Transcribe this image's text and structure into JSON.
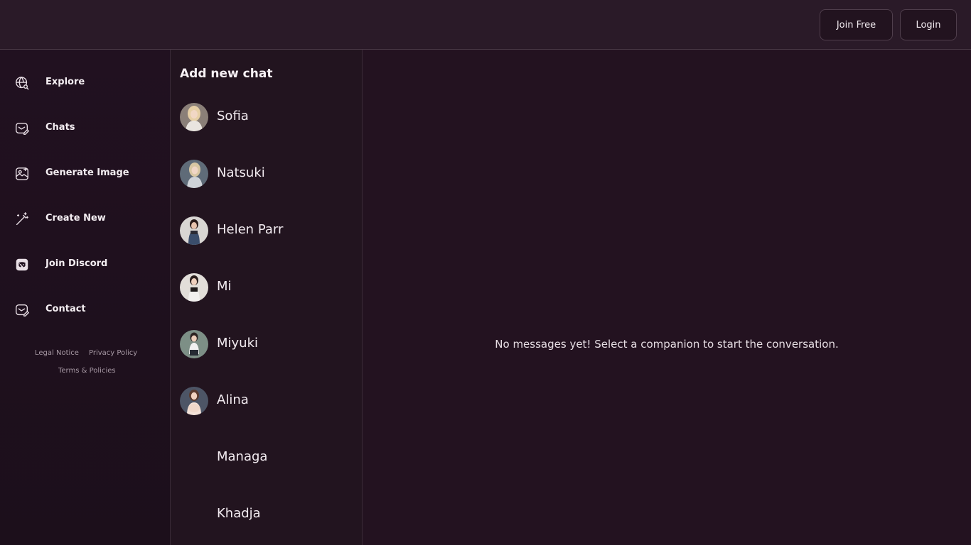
{
  "header": {
    "join_label": "Join Free",
    "login_label": "Login"
  },
  "sidebar": {
    "items": [
      {
        "label": "Explore",
        "icon": "globe-search-icon"
      },
      {
        "label": "Chats",
        "icon": "chat-edit-icon"
      },
      {
        "label": "Generate Image",
        "icon": "image-generate-icon"
      },
      {
        "label": "Create New",
        "icon": "magic-wand-icon"
      },
      {
        "label": "Join Discord",
        "icon": "discord-icon"
      },
      {
        "label": "Contact",
        "icon": "mail-edit-icon"
      }
    ],
    "footer": {
      "legal": "Legal Notice",
      "privacy": "Privacy Policy",
      "terms": "Terms & Policies"
    }
  },
  "contacts": {
    "title": "Add new chat",
    "items": [
      {
        "name": "Sofia"
      },
      {
        "name": "Natsuki"
      },
      {
        "name": "Helen Parr"
      },
      {
        "name": "Mi"
      },
      {
        "name": "Miyuki"
      },
      {
        "name": "Alina"
      },
      {
        "name": "Managa"
      },
      {
        "name": "Khadja"
      }
    ]
  },
  "main": {
    "empty_message": "No messages yet! Select a companion to start the conversation."
  },
  "colors": {
    "background": "#22111f",
    "header": "#2a1a28",
    "border": "#4a3a47",
    "text": "#f1e9ef"
  }
}
